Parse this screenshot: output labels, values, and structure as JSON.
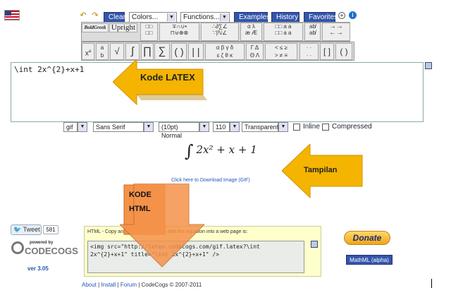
{
  "toolbar": {
    "clear": "Clear",
    "colors": "Colors...",
    "functions": "Functions...",
    "examples": "Examples",
    "history": "History",
    "favorites": "Favorites"
  },
  "palette": {
    "boldgreek": "BoldGreek",
    "upright": "Upright"
  },
  "editor": {
    "content": "\\int 2x^{2}+x+1"
  },
  "options": {
    "format": "gif",
    "font": "Sans Serif",
    "size": "(10pt) Normal",
    "dpi": "110",
    "background": "Transparent",
    "inline_label": "Inline",
    "compressed_label": "Compressed"
  },
  "output": {
    "formula_int": "∫",
    "formula_rest": "2x² + x + 1",
    "download_link": "Click here to Download Image (GIF)"
  },
  "annotations": {
    "latex": "Kode LATEX",
    "tampilan": "Tampilan",
    "html_line1": "KODE",
    "html_line2": "HTML"
  },
  "html_box": {
    "label": "HTML - Copy and paste this code to add this equation into a web page is:",
    "code": "<img src=\"http://latex.codecogs.com/gif.latex?\\int\n2x^{2}+x+1\" title=\"\\int 2x^{2}+x+1\" />"
  },
  "tweet": {
    "label": "Tweet",
    "count": "581"
  },
  "brand": {
    "powered": "powered by",
    "name": "CODECOGS",
    "version": "ver 3.05"
  },
  "donate": "Donate",
  "mathml": "MathML (alpha)",
  "footer": {
    "about": "About",
    "install": "Install",
    "forum": "Forum",
    "copyright": "CodeCogs © 2007-2011"
  },
  "colors": {
    "arrow_yellow": "#f4b400",
    "arrow_orange": "#f5924a",
    "button_blue": "#3355aa"
  }
}
